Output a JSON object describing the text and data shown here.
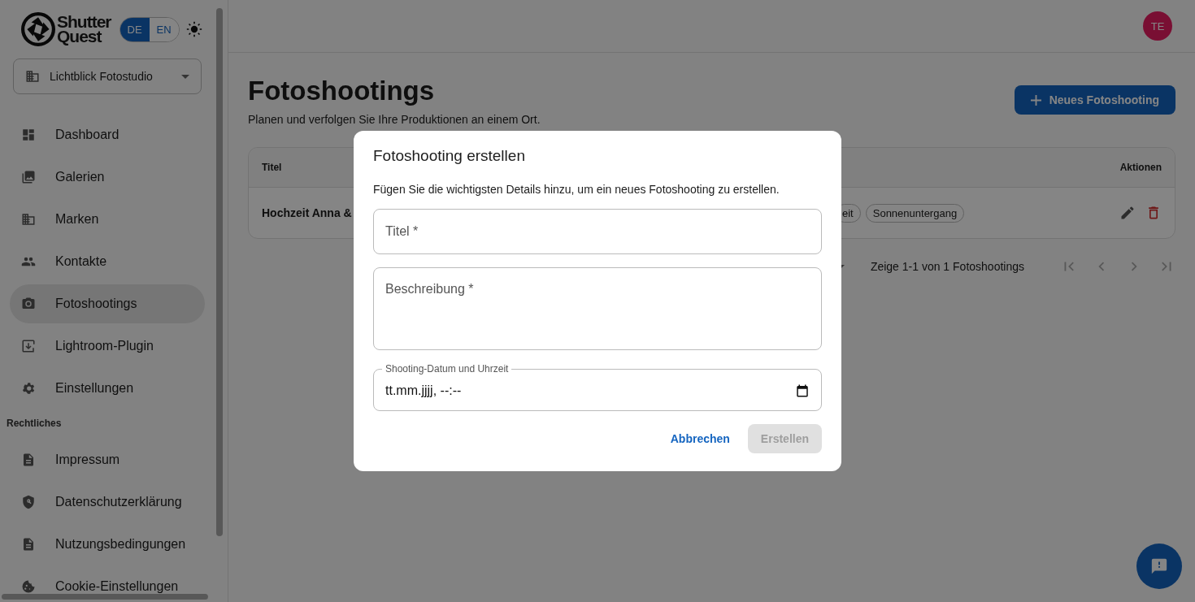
{
  "sidebar": {
    "logo": {
      "line1": "Shutter",
      "line2": "Quest"
    },
    "languages": [
      {
        "label": "DE",
        "selected": true
      },
      {
        "label": "EN",
        "selected": false
      }
    ],
    "studio_select": {
      "value": "Lichtblick Fotostudio"
    },
    "items": [
      {
        "label": "Dashboard",
        "selected": false
      },
      {
        "label": "Galerien",
        "selected": false
      },
      {
        "label": "Marken",
        "selected": false
      },
      {
        "label": "Kontakte",
        "selected": false
      },
      {
        "label": "Fotoshootings",
        "selected": true
      },
      {
        "label": "Lightroom-Plugin",
        "selected": false
      },
      {
        "label": "Einstellungen",
        "selected": false
      }
    ],
    "section": "Rechtliches",
    "legal_items": [
      {
        "label": "Impressum",
        "selected": false
      },
      {
        "label": "Datenschutzerklärung",
        "selected": false
      },
      {
        "label": "Nutzungsbedingungen",
        "selected": false
      },
      {
        "label": "Cookie-Einstellungen",
        "selected": false
      }
    ]
  },
  "topbar": {
    "avatar": "TE"
  },
  "page": {
    "title": "Fotoshootings",
    "subtitle": "Planen und verfolgen Sie Ihre Produktionen an einem Ort.",
    "new_button": "Neues Fotoshooting"
  },
  "table": {
    "columns": [
      "Titel",
      "Aktionen"
    ],
    "rows": [
      {
        "title": "Hochzeit Anna &",
        "tags": [
          "eit",
          "Sonnenuntergang"
        ]
      }
    ],
    "pagination": "Zeige 1-1 von 1 Fotoshootings"
  },
  "dialog": {
    "title": "Fotoshooting erstellen",
    "description": "Fügen Sie die wichtigsten Details hinzu, um ein neues Fotoshooting zu erstellen.",
    "fields": [
      {
        "kind": "text",
        "label": "Titel *"
      },
      {
        "kind": "textarea",
        "label": "Beschreibung *"
      },
      {
        "kind": "datetime",
        "label": "Shooting-Datum und Uhrzeit",
        "placeholder": "tt.mm.jjjj, --:--"
      }
    ],
    "cancel": "Abbrechen",
    "submit": {
      "label": "Erstellen",
      "disabled": true
    }
  }
}
